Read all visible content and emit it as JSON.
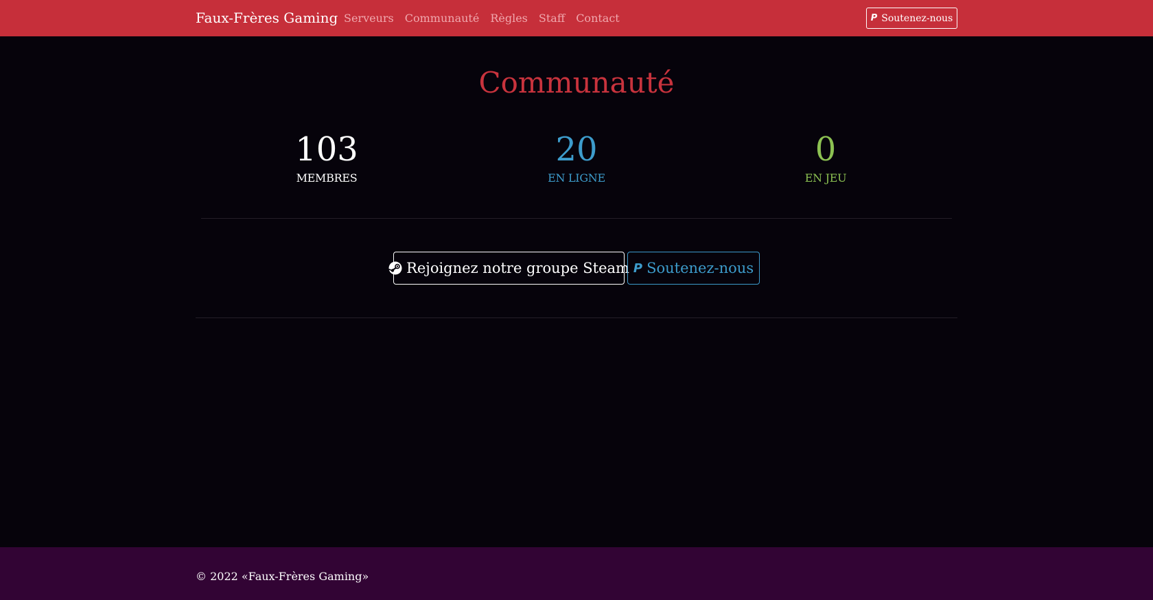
{
  "navbar": {
    "brand": "Faux-Frères Gaming",
    "items": [
      {
        "label": "Serveurs"
      },
      {
        "label": "Communauté"
      },
      {
        "label": "Règles"
      },
      {
        "label": "Staff"
      },
      {
        "label": "Contact"
      }
    ],
    "donate_label": "Soutenez-nous",
    "donate_icon": "paypal-icon"
  },
  "main": {
    "title": "Communauté",
    "stats": {
      "members": {
        "value": "103",
        "label": "MEMBRES"
      },
      "online": {
        "value": "20",
        "label": "EN LIGNE"
      },
      "ingame": {
        "value": "0",
        "label": "EN JEU"
      }
    },
    "steam_button": {
      "label": "Rejoignez notre groupe Steam",
      "icon": "steam-icon"
    },
    "donate_button": {
      "label": "Soutenez-nous",
      "icon": "paypal-icon"
    }
  },
  "footer": {
    "copyright": "© 2022 «Faux-Frères Gaming»"
  },
  "colors": {
    "navbar_bg": "#c62f3a",
    "page_bg": "#06030b",
    "title": "#c8333d",
    "online": "#3d9ccc",
    "ingame": "#8cc152",
    "footer_bg": "#320434"
  }
}
